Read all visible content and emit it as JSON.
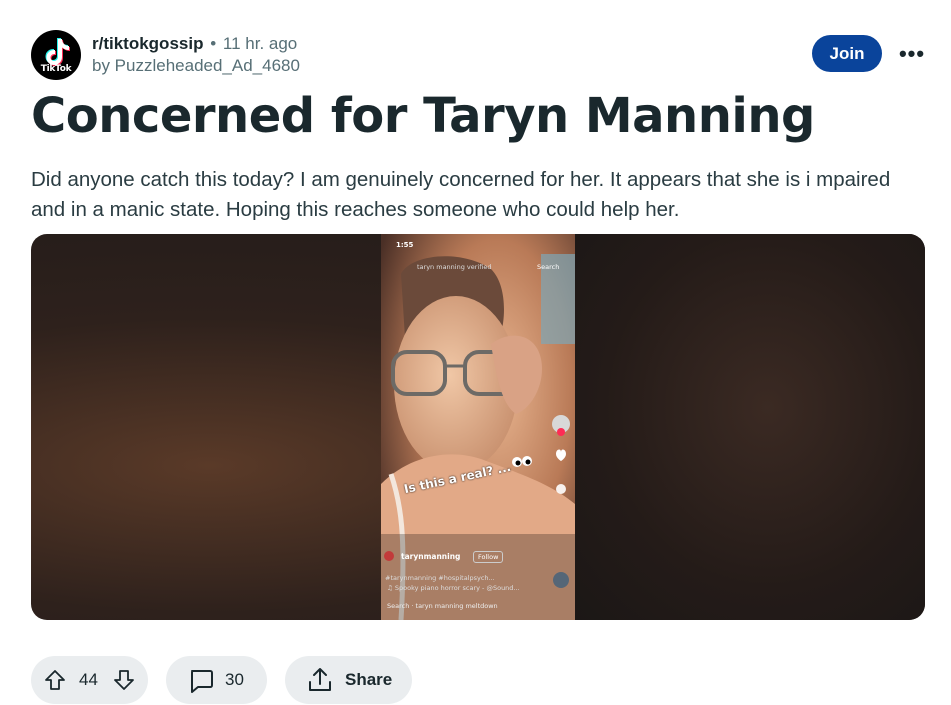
{
  "post": {
    "subreddit": "r/tiktokgossip",
    "separator": "•",
    "time_ago": "11 hr. ago",
    "author": "by Puzzleheaded_Ad_4680",
    "avatar_text": "TikTok",
    "join_label": "Join",
    "more_label": "•••",
    "title": "Concerned for Taryn Manning",
    "body": "Did anyone catch this today? I am genuinely concerned for her. It appears that she is i mpaired and in a manic state. Hoping this reaches someone who could help her."
  },
  "media": {
    "status_time": "1:55",
    "search_query": "taryn manning verified",
    "search_button": "Search",
    "caption": "Is this a real? ...",
    "handle": "tarynmanning",
    "follow_label": "Follow",
    "hashtags": "#tarynmanning #hospitalpsych...",
    "sound": "♫ Spooky piano horror scary - @Sound...",
    "bottom_search": "Search · taryn manning meltdown"
  },
  "actions": {
    "vote_count": "44",
    "comment_count": "30",
    "share_label": "Share"
  },
  "colors": {
    "join_bg": "#0a449b",
    "pill_bg": "#eaedef",
    "text_primary": "#1a282d",
    "text_meta": "#576f76"
  }
}
